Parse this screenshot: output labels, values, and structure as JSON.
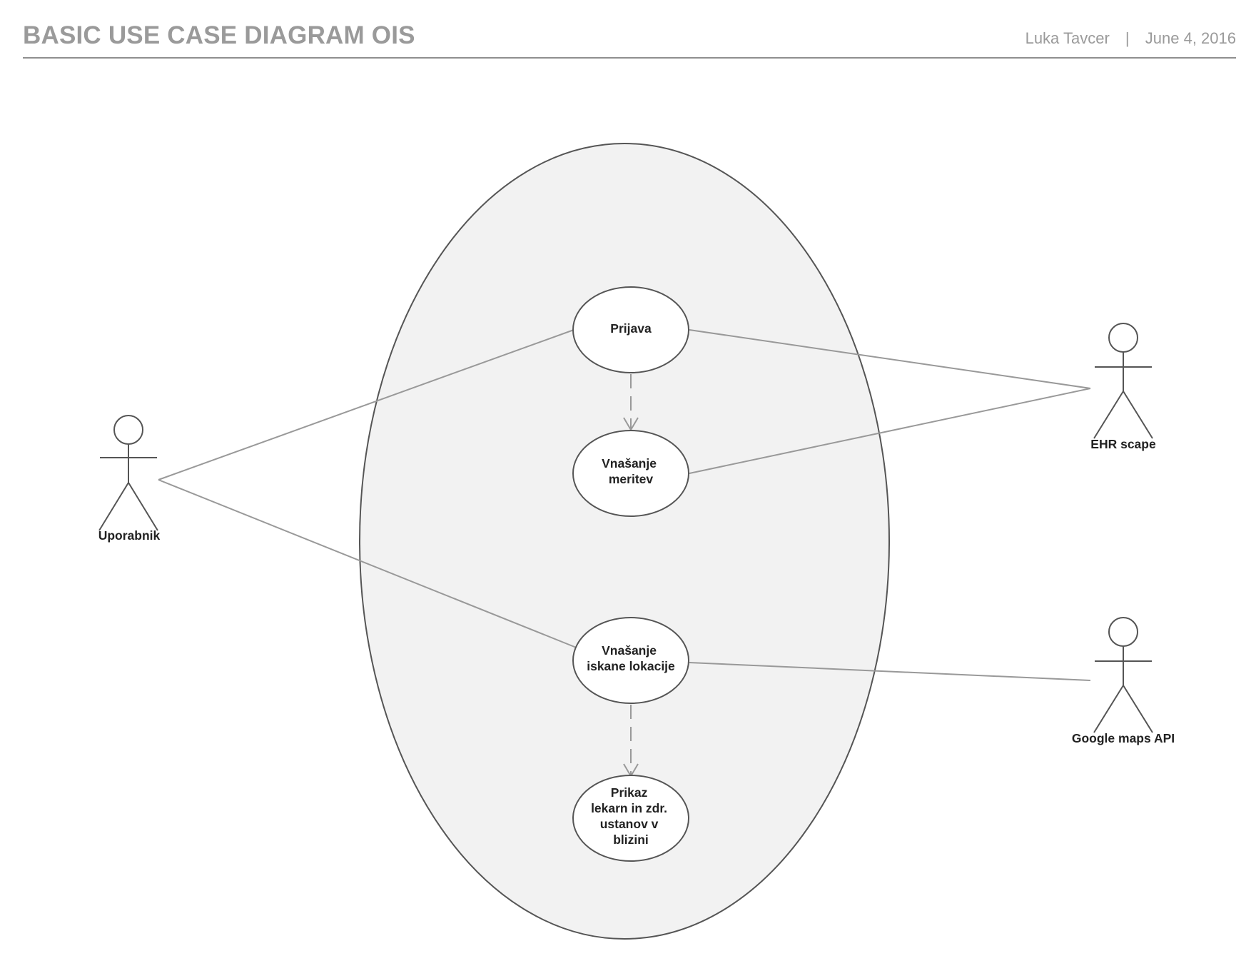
{
  "header": {
    "title": "BASIC USE CASE DIAGRAM OIS",
    "author": "Luka Tavcer",
    "separator": "|",
    "date": "June 4, 2016"
  },
  "actors": {
    "uporabnik": "Uporabnik",
    "ehr": "EHR scape",
    "google": "Google maps API"
  },
  "use_cases": {
    "prijava": [
      "Prijava"
    ],
    "meritev": [
      "Vnašanje",
      "meritev"
    ],
    "lokacija": [
      "Vnašanje",
      "iskane lokacije"
    ],
    "prikaz": [
      "Prikaz",
      "lekarn in zdr.",
      "ustanov v",
      "blizini"
    ]
  },
  "colors": {
    "system_fill": "#f2f2f2",
    "stroke": "#555555",
    "association": "#999999"
  }
}
